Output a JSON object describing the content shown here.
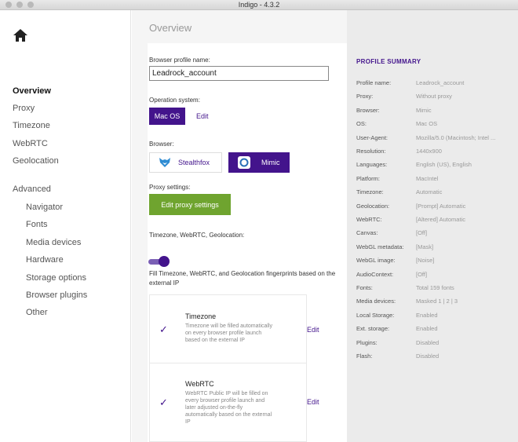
{
  "window": {
    "title": "Indigo - 4.3.2"
  },
  "sidebar": {
    "items": [
      {
        "label": "Overview"
      },
      {
        "label": "Proxy"
      },
      {
        "label": "Timezone"
      },
      {
        "label": "WebRTC"
      },
      {
        "label": "Geolocation"
      }
    ],
    "advanced_label": "Advanced",
    "advanced_items": [
      {
        "label": "Navigator"
      },
      {
        "label": "Fonts"
      },
      {
        "label": "Media devices"
      },
      {
        "label": "Hardware"
      },
      {
        "label": "Storage options"
      },
      {
        "label": "Browser plugins"
      },
      {
        "label": "Other"
      }
    ]
  },
  "main": {
    "title": "Overview",
    "profile_name_label": "Browser profile name:",
    "profile_name_value": "Leadrock_account",
    "os_label": "Operation system:",
    "os_value": "Mac OS",
    "os_edit": "Edit",
    "browser_label": "Browser:",
    "browsers": [
      {
        "label": "Stealthfox"
      },
      {
        "label": "Mimic"
      }
    ],
    "proxy_label": "Proxy settings:",
    "proxy_button": "Edit proxy settings",
    "geo_label": "Timezone, WebRTC, Geolocation:",
    "geo_desc": "Fill Timezone, WebRTC, and Geolocation fingerprints based on the external IP",
    "subs": [
      {
        "title": "Timezone",
        "text": "Timezone will be filled automatically on every browser profile launch based on the external IP",
        "edit": "Edit"
      },
      {
        "title": "WebRTC",
        "text": "WebRTC Public IP will be filled on every browser profile launch and later adjusted on-the-fly automatically based on the external IP",
        "edit": "Edit"
      }
    ]
  },
  "summary": {
    "title": "PROFILE SUMMARY",
    "rows": [
      {
        "k": "Profile name:",
        "v": "Leadrock_account"
      },
      {
        "k": "Proxy:",
        "v": "Without proxy"
      },
      {
        "k": "Browser:",
        "v": "Mimic"
      },
      {
        "k": "OS:",
        "v": "Mac OS"
      },
      {
        "k": "User-Agent:",
        "v": "Mozilla/5.0 (Macintosh; Intel ..."
      },
      {
        "k": "Resolution:",
        "v": "1440x900"
      },
      {
        "k": "Languages:",
        "v": "English (US), English"
      },
      {
        "k": "Platform:",
        "v": "MacIntel"
      },
      {
        "k": "Timezone:",
        "v": "Automatic"
      },
      {
        "k": "Geolocation:",
        "v": "[Prompt] Automatic"
      },
      {
        "k": "WebRTC:",
        "v": "[Altered] Automatic"
      },
      {
        "k": "Canvas:",
        "v": "[Off]"
      },
      {
        "k": "WebGL metadata:",
        "v": "[Mask]"
      },
      {
        "k": "WebGL image:",
        "v": "[Noise]"
      },
      {
        "k": "AudioContext:",
        "v": "[Off]"
      },
      {
        "k": "Fonts:",
        "v": "Total 159 fonts"
      },
      {
        "k": "Media devices:",
        "v": "Masked 1 | 2 | 3"
      },
      {
        "k": "Local Storage:",
        "v": "Enabled"
      },
      {
        "k": "Ext. storage:",
        "v": "Enabled"
      },
      {
        "k": "Plugins:",
        "v": "Disabled"
      },
      {
        "k": "Flash:",
        "v": "Disabled"
      }
    ]
  },
  "colors": {
    "accent": "#43148c",
    "proxy_button": "#6fa42f",
    "summary_bg": "#ebebeb"
  }
}
